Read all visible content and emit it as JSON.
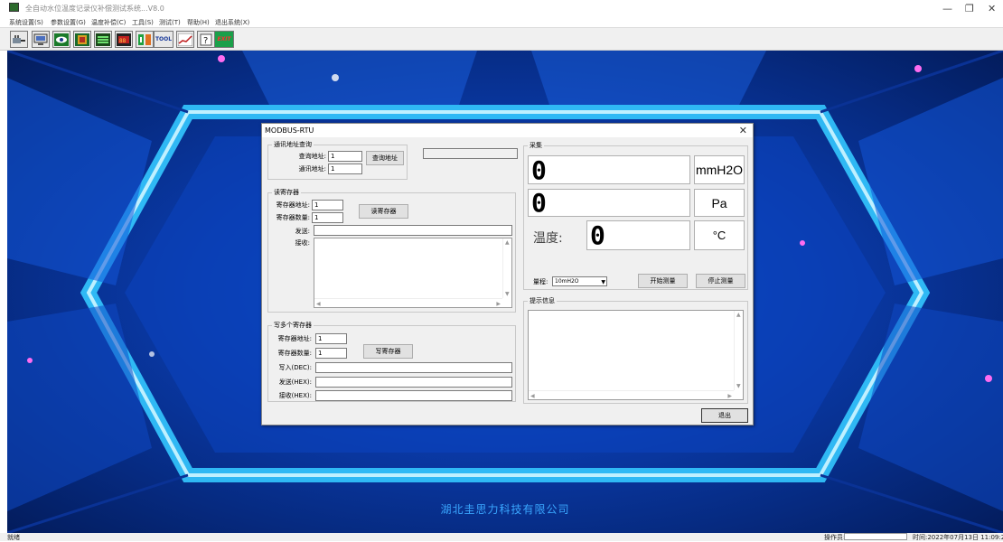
{
  "window": {
    "title": "全自动水位温度记录仪补偿测试系统...V8.0",
    "minimize": "—",
    "maximize": "❐",
    "close": "✕"
  },
  "menu": [
    "系统设置(S)",
    "参数设置(G)",
    "温度补偿(C)",
    "工具(S)",
    "测试(T)",
    "帮助(H)",
    "退出系统(X)"
  ],
  "toolbar": {
    "tool_label": "TOOL",
    "exit_label": "EXIT"
  },
  "company": "湖北圭思力科技有限公司",
  "status": {
    "left": "就绪",
    "operator_label": "操作员:",
    "time": "时间:2022年07月13日 11:09:26"
  },
  "dialog": {
    "title": "MODBUS-RTU",
    "close": "✕",
    "address_group": {
      "title": "通讯地址查询",
      "query_label": "查询地址:",
      "query_value": "1",
      "comm_label": "通讯地址:",
      "comm_value": "1",
      "button": "查询地址"
    },
    "read_group": {
      "title": "读寄存器",
      "addr_label": "寄存器地址:",
      "addr_value": "1",
      "count_label": "寄存器数量:",
      "count_value": "1",
      "button": "读寄存器",
      "send_label": "发送:",
      "recv_label": "接收:"
    },
    "write_group": {
      "title": "写多个寄存器",
      "addr_label": "寄存器地址:",
      "addr_value": "1",
      "count_label": "寄存器数量:",
      "count_value": "1",
      "button": "写寄存器",
      "write_label": "写入(DEC):",
      "send_label": "发送(HEX):",
      "recv_label": "接收(HEX):"
    },
    "collect_group": {
      "title": "采集",
      "value1": "0",
      "unit1": "mmH2O",
      "value2": "0",
      "unit2": "Pa",
      "temp_label": "温度:",
      "temp_value": "0",
      "temp_unit": "°C",
      "range_label": "量程:",
      "range_value": "10mH2O",
      "start_button": "开始测量",
      "stop_button": "停止测量"
    },
    "info_group": {
      "title": "提示信息"
    },
    "exit_button": "退出"
  }
}
